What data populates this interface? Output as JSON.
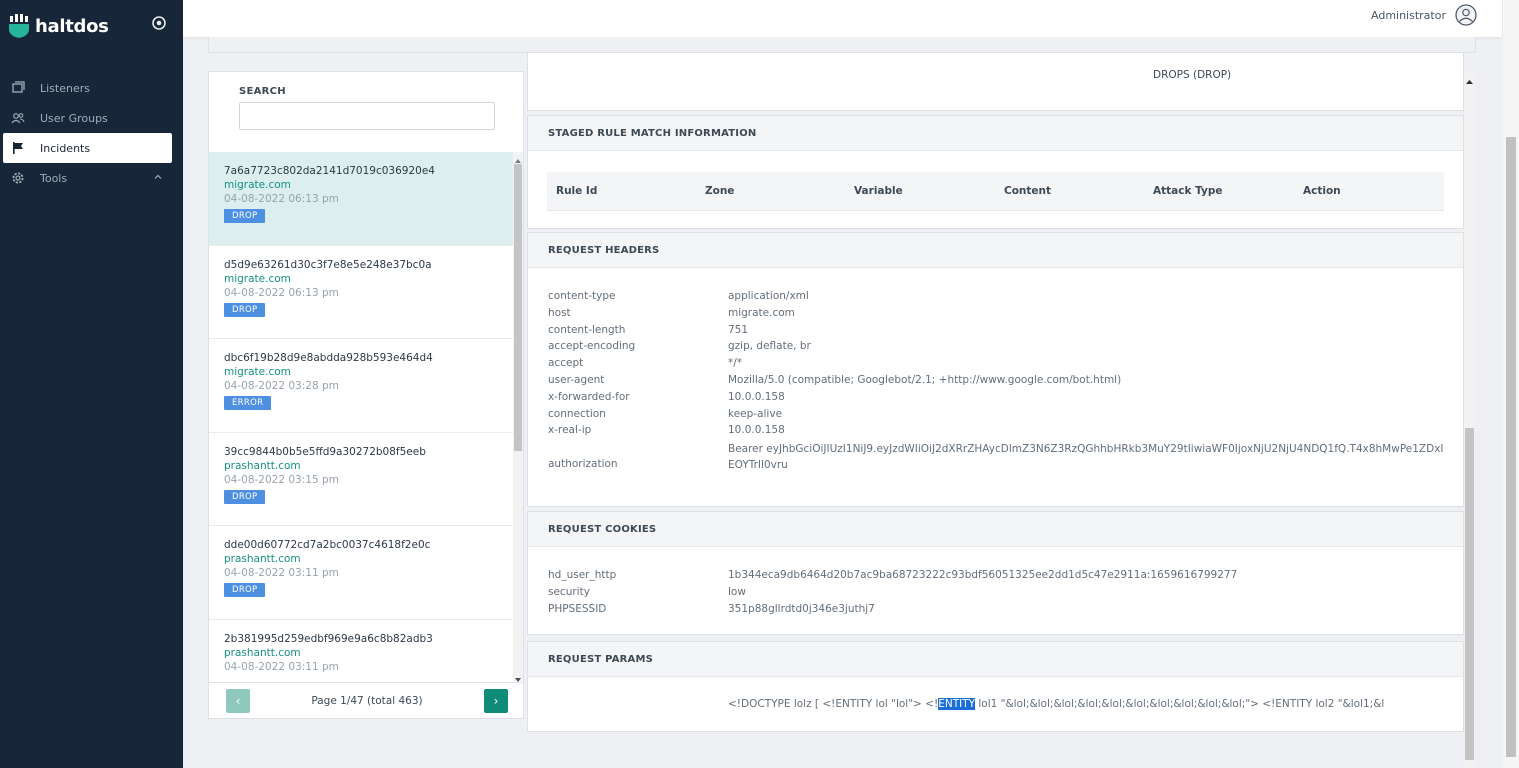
{
  "app": {
    "name": "haltdos"
  },
  "header": {
    "user_label": "Administrator"
  },
  "sidebar": {
    "items": [
      {
        "label": "Listeners",
        "icon": "window-icon"
      },
      {
        "label": "User Groups",
        "icon": "users-icon"
      },
      {
        "label": "Incidents",
        "icon": "flag-icon",
        "active": true
      },
      {
        "label": "Tools",
        "icon": "gear-icon",
        "expandable": true
      }
    ]
  },
  "search": {
    "label": "SEARCH",
    "value": ""
  },
  "incidents": [
    {
      "id": "7a6a7723c802da2141d7019c036920e4",
      "host": "migrate.com",
      "time": "04-08-2022 06:13 pm",
      "badge": "DROP"
    },
    {
      "id": "d5d9e63261d30c3f7e8e5e248e37bc0a",
      "host": "migrate.com",
      "time": "04-08-2022 06:13 pm",
      "badge": "DROP"
    },
    {
      "id": "dbc6f19b28d9e8abdda928b593e464d4",
      "host": "migrate.com",
      "time": "04-08-2022 03:28 pm",
      "badge": "ERROR"
    },
    {
      "id": "39cc9844b0b5e5ffd9a30272b08f5eeb",
      "host": "prashantt.com",
      "time": "04-08-2022 03:15 pm",
      "badge": "DROP"
    },
    {
      "id": "dde00d60772cd7a2bc0037c4618f2e0c",
      "host": "prashantt.com",
      "time": "04-08-2022 03:11 pm",
      "badge": "DROP"
    },
    {
      "id": "2b381995d259edbf969e9a6c8b82adb3",
      "host": "prashantt.com",
      "time": "04-08-2022 03:11 pm",
      "badge": ""
    }
  ],
  "pager": {
    "text": "Page 1/47 (total 463)",
    "prev": "‹",
    "next": "›"
  },
  "summary": {
    "action_text": "DROPS (DROP)"
  },
  "staged_rule": {
    "title": "STAGED RULE MATCH INFORMATION",
    "columns": [
      "Rule Id",
      "Zone",
      "Variable",
      "Content",
      "Attack Type",
      "Action"
    ]
  },
  "request_headers": {
    "title": "REQUEST HEADERS",
    "rows": [
      {
        "key": "content-type",
        "value": "application/xml"
      },
      {
        "key": "host",
        "value": "migrate.com"
      },
      {
        "key": "content-length",
        "value": "751"
      },
      {
        "key": "accept-encoding",
        "value": "gzip, deflate, br"
      },
      {
        "key": "accept",
        "value": "*/*"
      },
      {
        "key": "user-agent",
        "value": "Mozilla/5.0 (compatible; Googlebot/2.1; +http://www.google.com/bot.html)"
      },
      {
        "key": "x-forwarded-for",
        "value": "10.0.0.158"
      },
      {
        "key": "connection",
        "value": "keep-alive"
      },
      {
        "key": "x-real-ip",
        "value": "10.0.0.158"
      }
    ],
    "auth_key": "authorization",
    "auth_value": "Bearer eyJhbGciOiJIUzI1NiJ9.eyJzdWIiOiJ2dXRrZHAycDlmZ3N6Z3RzQGhhbHRkb3MuY29tIiwiaWF0IjoxNjU2NjU4NDQ1fQ.T4x8hMwPe1ZDxIEOYTrIl0vru"
  },
  "request_cookies": {
    "title": "REQUEST COOKIES",
    "rows": [
      {
        "key": "hd_user_http",
        "value": "1b344eca9db6464d20b7ac9ba68723222c93bdf56051325ee2dd1d5c47e2911a:1659616799277"
      },
      {
        "key": "security",
        "value": "low"
      },
      {
        "key": "PHPSESSID",
        "value": "351p88gllrdtd0j346e3juthj7"
      }
    ]
  },
  "request_params": {
    "title": "REQUEST PARAMS",
    "before": "<!DOCTYPE lolz [ <!ENTITY lol \"lol\"> <!",
    "highlight": "ENTITY",
    "after": " lol1 \"&lol;&lol;&lol;&lol;&lol;&lol;&lol;&lol;&lol;&lol;\"> <!ENTITY lol2 \"&lol1;&l"
  },
  "colors": {
    "sidebar_bg": "#172638",
    "accent": "#0f8c78",
    "badge": "#4d8fe0",
    "host_text": "#169181"
  }
}
